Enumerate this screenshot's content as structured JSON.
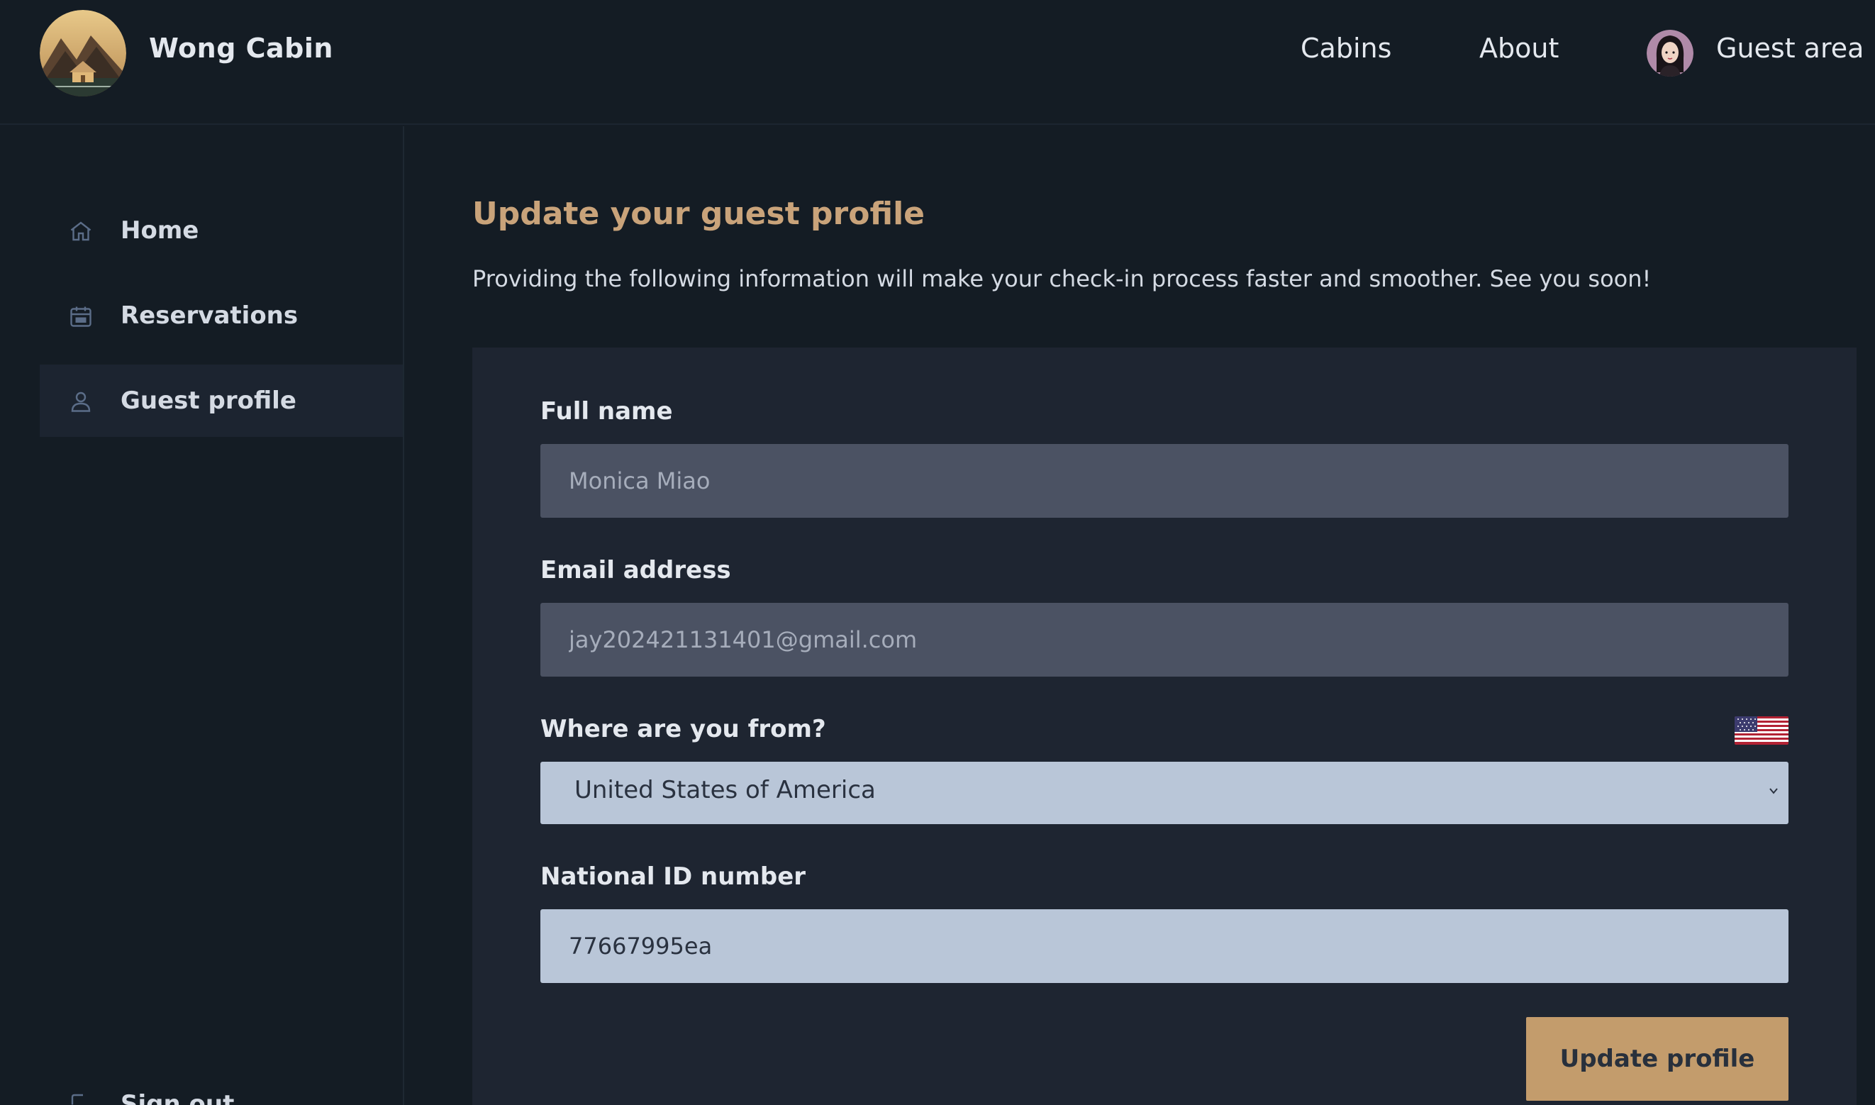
{
  "header": {
    "brand": "Wong Cabin",
    "nav": [
      "Cabins",
      "About",
      "Guest area"
    ]
  },
  "sidebar": {
    "items": [
      {
        "label": "Home",
        "icon": "home-icon"
      },
      {
        "label": "Reservations",
        "icon": "calendar-icon"
      },
      {
        "label": "Guest profile",
        "icon": "user-icon",
        "active": true
      }
    ],
    "signout_label": "Sign out"
  },
  "main": {
    "title": "Update your guest profile",
    "description": "Providing the following information will make your check-in process faster and smoother. See you soon!"
  },
  "form": {
    "full_name_label": "Full name",
    "full_name_value": "Monica Miao",
    "email_label": "Email address",
    "email_value": "jay202421131401@gmail.com",
    "country_label": "Where are you from?",
    "country_value": "United States of America",
    "national_id_label": "National ID number",
    "national_id_value": "77667995ea",
    "submit_label": "Update profile"
  },
  "colors": {
    "accent": "#c39c6c",
    "title": "#c9a37a",
    "background": "#141c24",
    "card": "#1e2531"
  }
}
